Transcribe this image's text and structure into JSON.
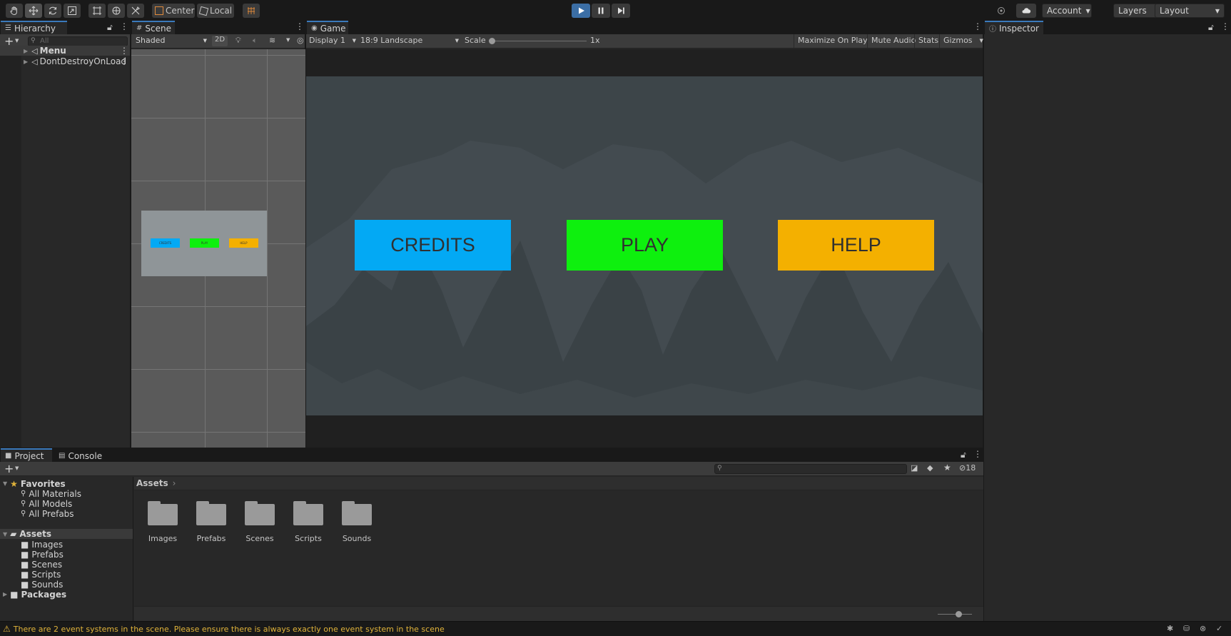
{
  "toolbar": {
    "pivot_label": "Center",
    "space_label": "Local",
    "account_label": "Account",
    "layers_label": "Layers",
    "layout_label": "Layout"
  },
  "hierarchy": {
    "tab_label": "Hierarchy",
    "search_placeholder": "All",
    "items": [
      {
        "label": "Menu"
      },
      {
        "label": "DontDestroyOnLoad"
      }
    ]
  },
  "scene": {
    "tab_label": "Scene",
    "shading_mode": "Shaded",
    "mode_2d": "2D",
    "mini_labels": [
      "CREDITS",
      "PLAY",
      "HELP"
    ]
  },
  "game": {
    "tab_label": "Game",
    "display": "Display 1",
    "aspect": "18:9 Landscape",
    "scale_label": "Scale",
    "scale_value": "1x",
    "maximize_label": "Maximize On Play",
    "mute_label": "Mute Audio",
    "stats_label": "Stats",
    "gizmos_label": "Gizmos",
    "buttons": [
      {
        "label": "CREDITS",
        "color": "#03a9f4"
      },
      {
        "label": "PLAY",
        "color": "#0ef00e"
      },
      {
        "label": "HELP",
        "color": "#f4b000"
      }
    ]
  },
  "inspector": {
    "tab_label": "Inspector"
  },
  "project": {
    "tab_label": "Project",
    "console_tab_label": "Console",
    "breadcrumb": "Assets",
    "hidden_count": "18",
    "favorites_label": "Favorites",
    "favorites": [
      "All Materials",
      "All Models",
      "All Prefabs"
    ],
    "assets_label": "Assets",
    "asset_folders": [
      "Images",
      "Prefabs",
      "Scenes",
      "Scripts",
      "Sounds"
    ],
    "packages_label": "Packages",
    "grid_folders": [
      "Images",
      "Prefabs",
      "Scenes",
      "Scripts",
      "Sounds"
    ]
  },
  "status": {
    "message": "There are 2 event systems in the scene. Please ensure there is always exactly one event system in the scene"
  },
  "colors": {
    "accent": "#3a79bb",
    "play_active": "#3b6ea5",
    "warning": "#e0b33a"
  }
}
